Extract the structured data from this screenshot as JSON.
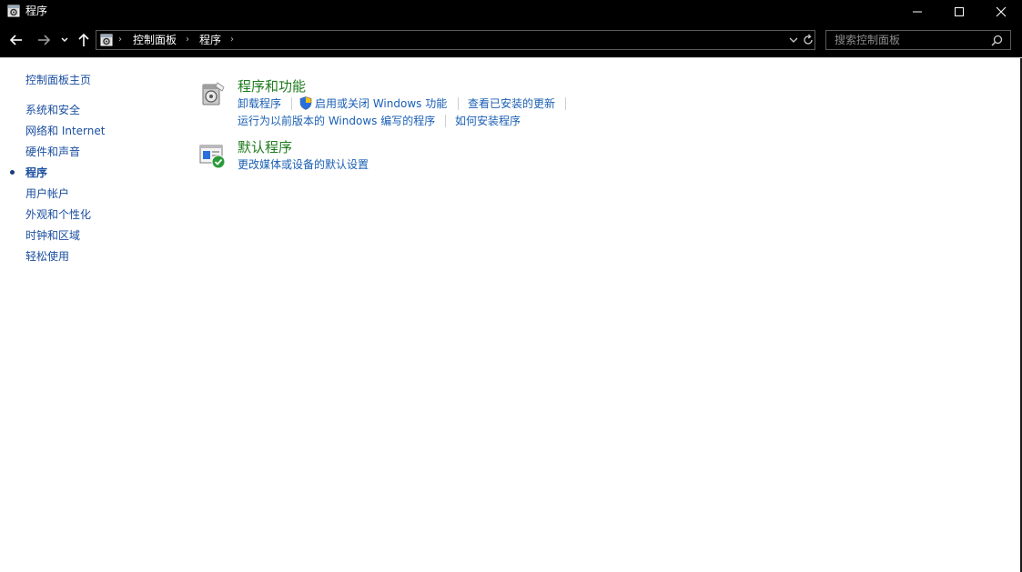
{
  "window": {
    "title": "程序"
  },
  "address": {
    "breadcrumbs": [
      "控制面板",
      "程序"
    ],
    "search_placeholder": "搜索控制面板"
  },
  "sidebar": {
    "home": "控制面板主页",
    "items": [
      {
        "label": "系统和安全",
        "active": false
      },
      {
        "label": "网络和 Internet",
        "active": false
      },
      {
        "label": "硬件和声音",
        "active": false
      },
      {
        "label": "程序",
        "active": true
      },
      {
        "label": "用户帐户",
        "active": false
      },
      {
        "label": "外观和个性化",
        "active": false
      },
      {
        "label": "时钟和区域",
        "active": false
      },
      {
        "label": "轻松使用",
        "active": false
      }
    ]
  },
  "groups": {
    "programs_features": {
      "title": "程序和功能",
      "links": [
        "卸载程序",
        "启用或关闭 Windows 功能",
        "查看已安装的更新",
        "运行为以前版本的 Windows 编写的程序",
        "如何安装程序"
      ]
    },
    "default_programs": {
      "title": "默认程序",
      "links": [
        "更改媒体或设备的默认设置"
      ]
    }
  },
  "colors": {
    "titlebar_bg": "#000000",
    "group_title": "#1e7b1e",
    "link": "#1a5fb4"
  }
}
